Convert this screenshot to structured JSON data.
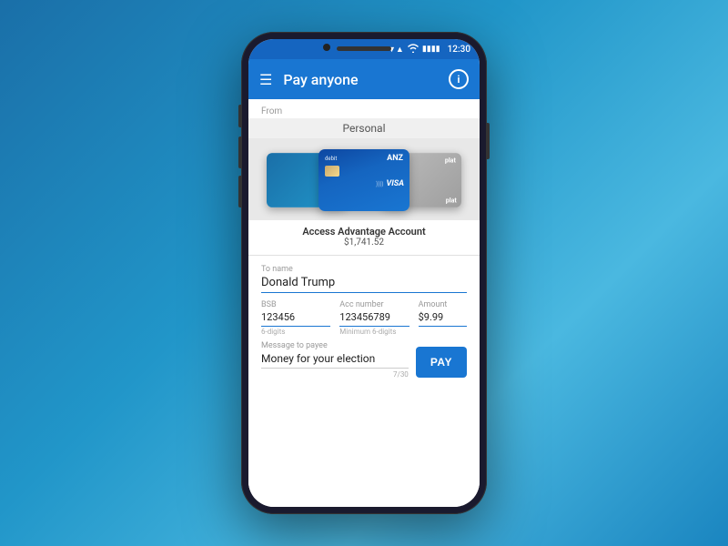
{
  "status_bar": {
    "time": "12:30",
    "signal": "▼▲",
    "wifi": "WiFi",
    "battery": "4"
  },
  "top_bar": {
    "menu_icon": "☰",
    "title": "Pay anyone",
    "info_icon": "i"
  },
  "from_section": {
    "label": "From",
    "personal_label": "Personal"
  },
  "cards": {
    "left": {
      "type": "visa"
    },
    "center": {
      "debit_label": "debit",
      "bank_label": "ANZ",
      "visa_label": "VISA"
    },
    "right": {
      "label": "plat"
    }
  },
  "account": {
    "name": "Access Advantage Account",
    "balance": "$1,741.52"
  },
  "form": {
    "to_name_label": "To name",
    "to_name_value": "Donald Trump",
    "bsb_label": "BSB",
    "bsb_value": "123456",
    "bsb_hint": "6-digits",
    "acc_label": "Acc number",
    "acc_value": "123456789",
    "acc_hint": "Minimum 6-digits",
    "amount_label": "Amount",
    "amount_value": "$9.99",
    "message_label": "Message to payee",
    "message_value": "Money for your election",
    "message_count": "7/30",
    "pay_button_label": "PAY"
  }
}
